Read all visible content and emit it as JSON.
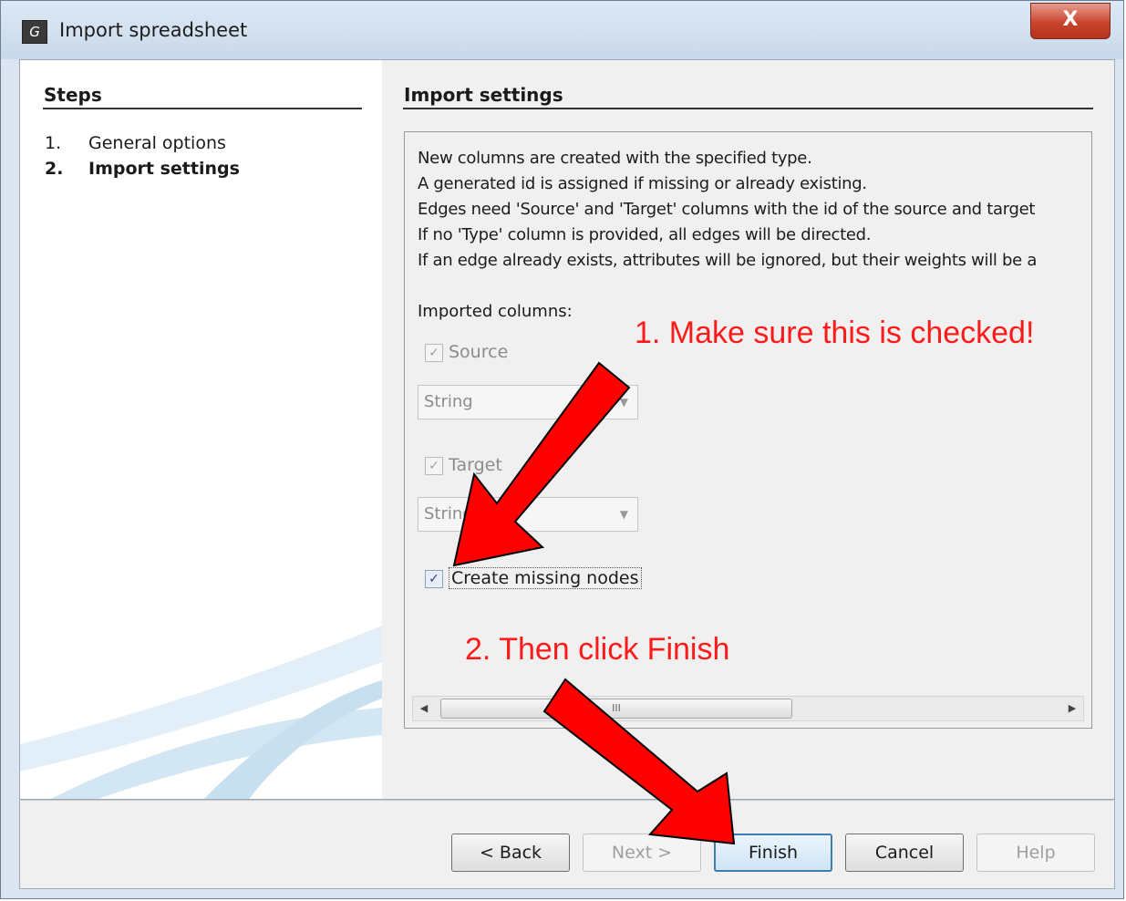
{
  "window": {
    "title": "Import spreadsheet",
    "close_symbol": "X"
  },
  "steps": {
    "title": "Steps",
    "items": [
      {
        "num": "1.",
        "label": "General options"
      },
      {
        "num": "2.",
        "label": "Import settings"
      }
    ]
  },
  "settings": {
    "title": "Import settings",
    "info_lines": [
      "New columns are created with the specified type.",
      "A generated id is assigned if missing or already existing.",
      "Edges need 'Source' and 'Target' columns with the id of the source and target",
      "If no 'Type' column is provided, all edges will be directed.",
      "If an edge already exists, attributes will be ignored, but their weights will be a"
    ],
    "imported_columns_label": "Imported columns:",
    "source": {
      "label": "Source",
      "checked": true,
      "type": "String"
    },
    "target": {
      "label": "Target",
      "checked": true,
      "type": "String"
    },
    "create_missing_nodes": {
      "label": "Create missing nodes",
      "checked": true
    },
    "scroll_thumb_grip": "III"
  },
  "buttons": {
    "back": "< Back",
    "next": "Next >",
    "finish": "Finish",
    "cancel": "Cancel",
    "help": "Help"
  },
  "annotations": {
    "note1": "1. Make sure this is checked!",
    "note2": "2. Then click Finish",
    "color": "#ff0000"
  }
}
